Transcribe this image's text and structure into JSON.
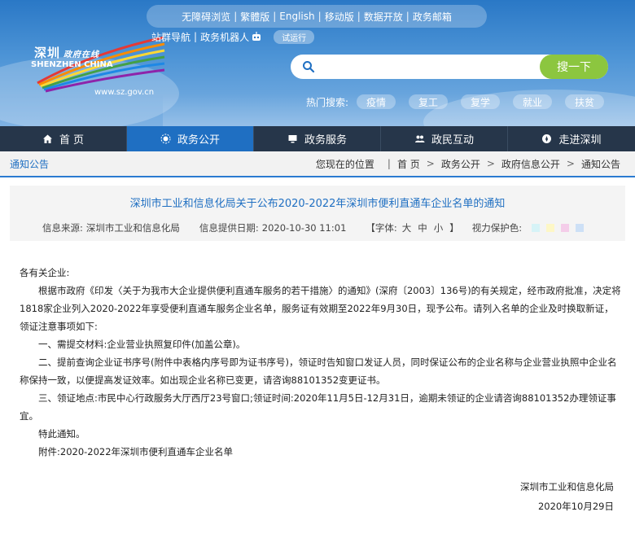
{
  "header": {
    "top_links": [
      "无障碍浏览",
      "繁體版",
      "English",
      "移动版",
      "数据开放",
      "政务邮箱"
    ],
    "sub_links": [
      "站群导航",
      "政务机器人"
    ],
    "trial_badge": "试运行",
    "logo_cn": "深圳",
    "logo_cn_small": "政府在线",
    "logo_en": "SHENZHEN CHINA",
    "logo_url": "www.sz.gov.cn",
    "search": {
      "placeholder": "",
      "button_label": "搜一下"
    },
    "hot_label": "热门搜索:",
    "hot_tags": [
      "疫情",
      "复工",
      "复学",
      "就业",
      "扶贫"
    ]
  },
  "nav": {
    "items": [
      "首 页",
      "政务公开",
      "政务服务",
      "政民互动",
      "走进深圳"
    ],
    "active_index": 1
  },
  "breadcrumb": {
    "section": "通知公告",
    "position_label": "您现在的位置",
    "path": [
      "首 页",
      "政务公开",
      "政府信息公开",
      "通知公告"
    ]
  },
  "article": {
    "title": "深圳市工业和信息化局关于公布2020-2022年深圳市便利直通车企业名单的通知",
    "source_label": "信息来源:",
    "source": "深圳市工业和信息化局",
    "date_label": "信息提供日期:",
    "date": "2020-10-30 11:01",
    "font_label": "【字体:",
    "font_sizes": [
      "大",
      "中",
      "小"
    ],
    "font_close": "】",
    "vision_label": "视力保护色:",
    "vision_colors": [
      "#d6f3f7",
      "#fdf7c6",
      "#f4cde9",
      "#cde0f6"
    ],
    "paragraphs": [
      "各有关企业:",
      "根据市政府《印发〈关于为我市大企业提供便利直通车服务的若干措施〉的通知》(深府〔2003〕136号)的有关规定，经市政府批准，决定将1818家企业列入2020-2022年享受便利直通车服务企业名单，服务证有效期至2022年9月30日，现予公布。请列入名单的企业及时换取新证，领证注意事项如下:",
      "一、需提交材料:企业营业执照复印件(加盖公章)。",
      "二、提前查询企业证书序号(附件中表格内序号即为证书序号)，领证时告知窗口发证人员，同时保证公布的企业名称与企业营业执照中企业名称保持一致，以便提高发证效率。如出现企业名称已变更，请咨询88101352变更证书。",
      "三、领证地点:市民中心行政服务大厅西厅23号窗口;领证时间:2020年11月5日-12月31日，逾期未领证的企业请咨询88101352办理领证事宜。",
      "特此通知。",
      "附件:2020-2022年深圳市便利直通车企业名单"
    ],
    "signature": "深圳市工业和信息化局",
    "sign_date": "2020年10月29日"
  }
}
